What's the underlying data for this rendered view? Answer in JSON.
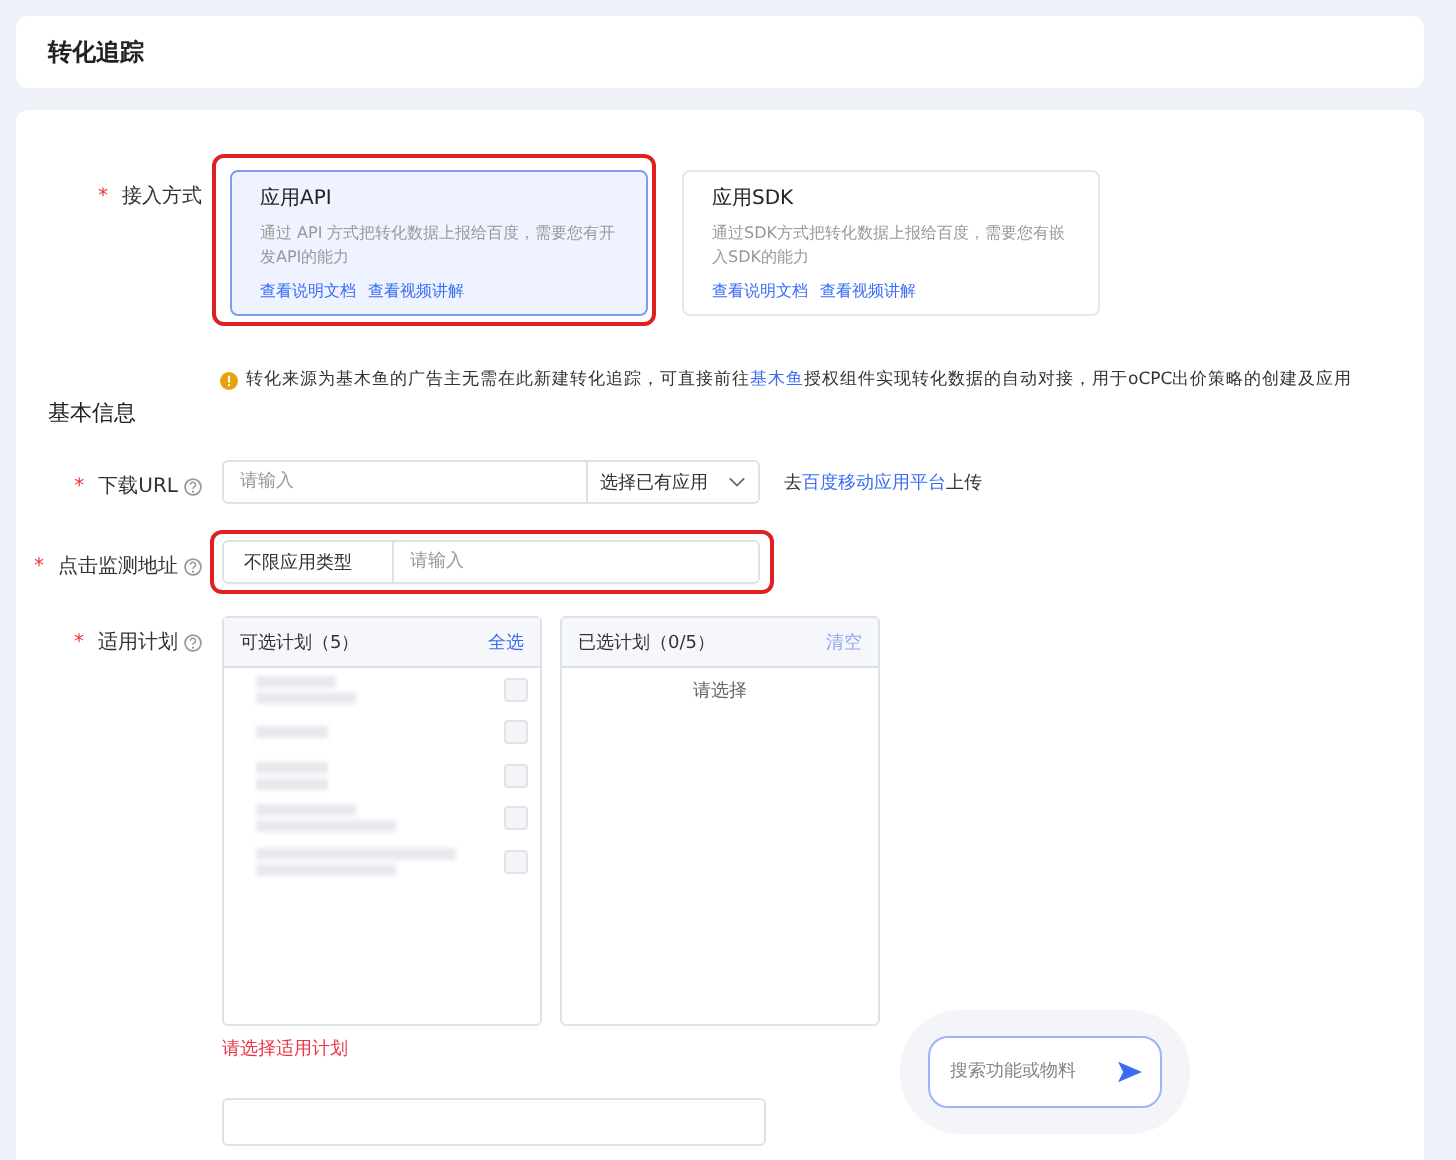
{
  "header": {
    "title": "转化追踪"
  },
  "access": {
    "label": "接入方式",
    "required_mark": "*",
    "highlighted": true,
    "options": [
      {
        "title": "应用API",
        "desc": "通过 API 方式把转化数据上报给百度，需要您有开发API的能力",
        "links": [
          "查看说明文档",
          "查看视频讲解"
        ],
        "selected": true
      },
      {
        "title": "应用SDK",
        "desc": "通过SDK方式把转化数据上报给百度，需要您有嵌入SDK的能力",
        "links": [
          "查看说明文档",
          "查看视频讲解"
        ],
        "selected": false
      }
    ]
  },
  "tip": {
    "before": "转化来源为基木鱼的广告主无需在此新建转化追踪，可直接前往",
    "link": "基木鱼",
    "after": "授权组件实现转化数据的自动对接，用于oCPC出价策略的创建及应用"
  },
  "section_title": "基本信息",
  "download_url": {
    "label": "下载URL",
    "required_mark": "*",
    "placeholder": "请输入",
    "select": "选择已有应用",
    "note_before": "去",
    "note_link": "百度移动应用平台",
    "note_after": "上传"
  },
  "click_monitor": {
    "label": "点击监测地址",
    "required_mark": "*",
    "highlighted": true,
    "type": "不限应用类型",
    "placeholder": "请输入"
  },
  "plans": {
    "label": "适用计划",
    "required_mark": "*",
    "available": {
      "title": "可选计划（5）",
      "action": "全选",
      "items": [
        {
          "checked": false
        },
        {
          "checked": false
        },
        {
          "checked": false
        },
        {
          "checked": false
        },
        {
          "checked": false
        }
      ]
    },
    "selected_panel": {
      "title": "已选计划（0/5）",
      "action": "清空",
      "empty": "请选择"
    },
    "error": "请选择适用计划"
  },
  "search": {
    "placeholder": "搜索功能或物料"
  }
}
